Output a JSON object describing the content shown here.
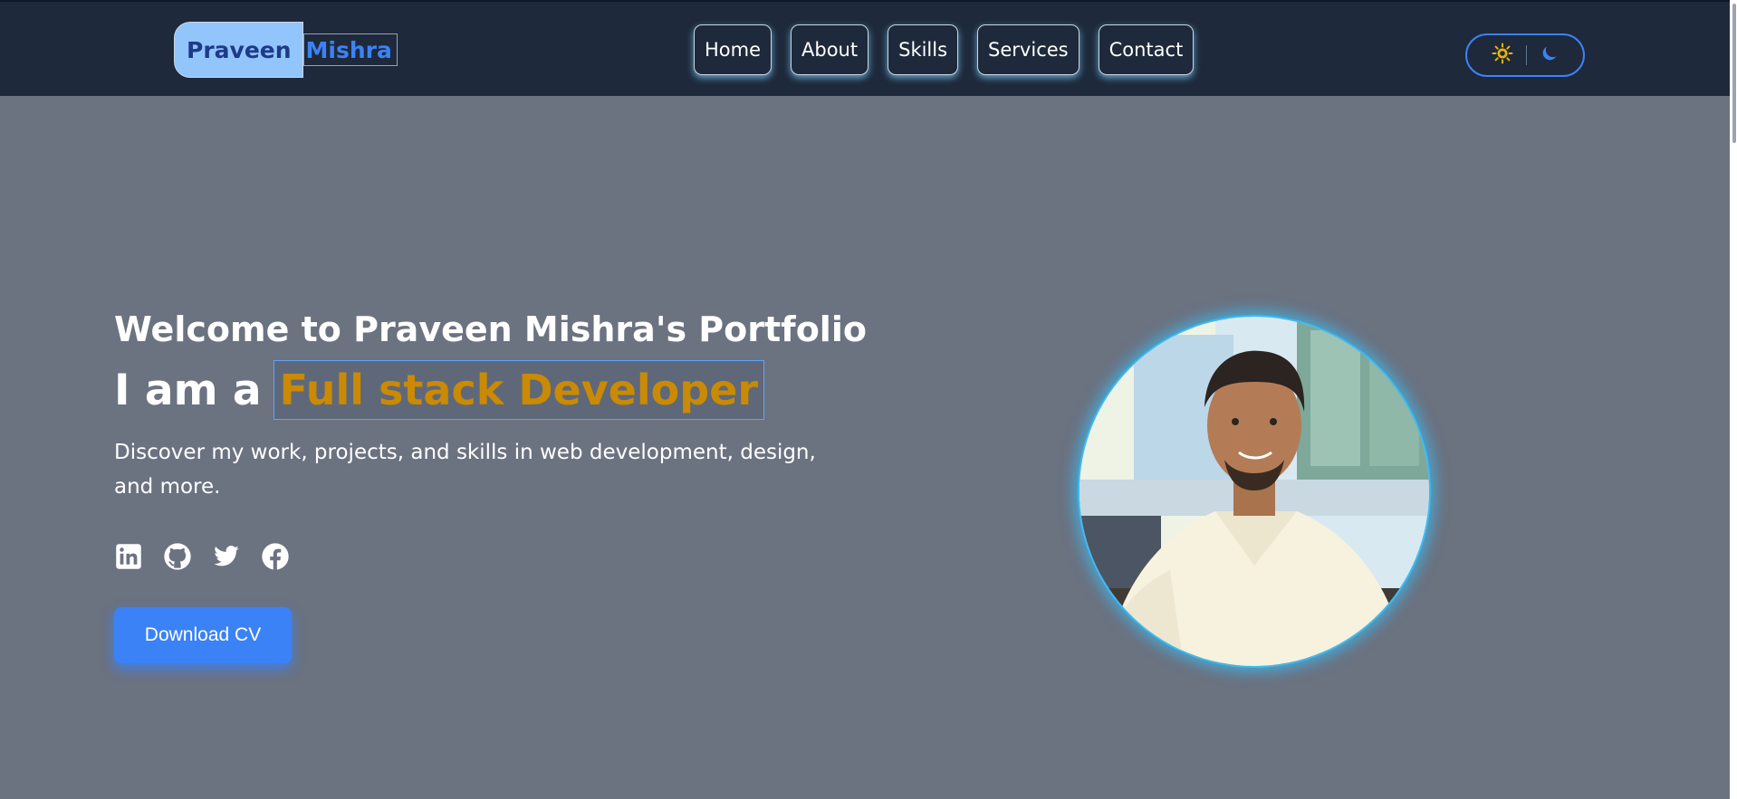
{
  "logo": {
    "first": "Praveen",
    "last": "Mishra"
  },
  "nav": {
    "items": [
      {
        "label": "Home"
      },
      {
        "label": "About"
      },
      {
        "label": "Skills"
      },
      {
        "label": "Services"
      },
      {
        "label": "Contact"
      }
    ]
  },
  "theme_toggle": {
    "light_icon": "sun-icon",
    "dark_icon": "moon-icon"
  },
  "hero": {
    "welcome": "Welcome to Praveen Mishra's Portfolio",
    "iam": "I am a",
    "role": "Full stack Developer",
    "description": "Discover my work, projects, and skills in web development, design, and more.",
    "socials": [
      {
        "icon": "linkedin-icon"
      },
      {
        "icon": "github-icon"
      },
      {
        "icon": "twitter-icon"
      },
      {
        "icon": "facebook-icon"
      }
    ],
    "cv_button": "Download CV"
  },
  "colors": {
    "navbar": "#1e293b",
    "page_bg": "#6b7280",
    "accent_blue": "#3b82f6",
    "role_text": "#ca8a04",
    "sun": "#eab308"
  }
}
